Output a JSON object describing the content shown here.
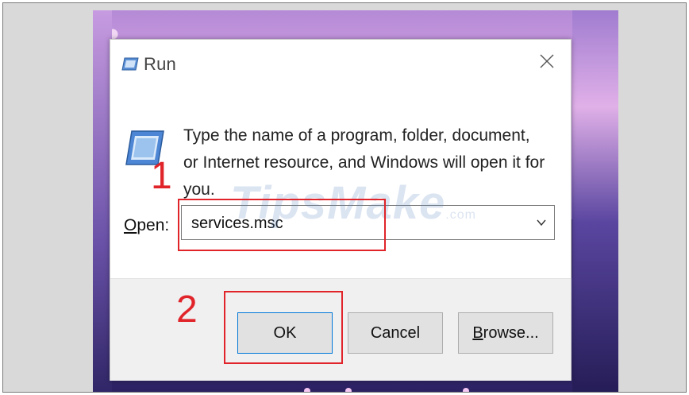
{
  "dialog": {
    "title": "Run",
    "description": "Type the name of a program, folder, document, or Internet resource, and Windows will open it for you.",
    "open_label_prefix": "",
    "open_label_underlined": "O",
    "open_label_rest": "pen:",
    "open_value": "services.msc",
    "buttons": {
      "ok": "OK",
      "cancel": "Cancel",
      "browse_underlined": "B",
      "browse_rest": "rowse..."
    }
  },
  "annotations": {
    "step1": "1",
    "step2": "2",
    "color": "#e0242a"
  },
  "watermark": {
    "text": "TipsMake",
    "suffix": ".com"
  },
  "icons": [
    "run-icon",
    "run-large-icon",
    "close-icon",
    "chevron-down-icon"
  ],
  "colors": {
    "focus_border": "#0078d7",
    "footer": "#f0f0f0"
  }
}
